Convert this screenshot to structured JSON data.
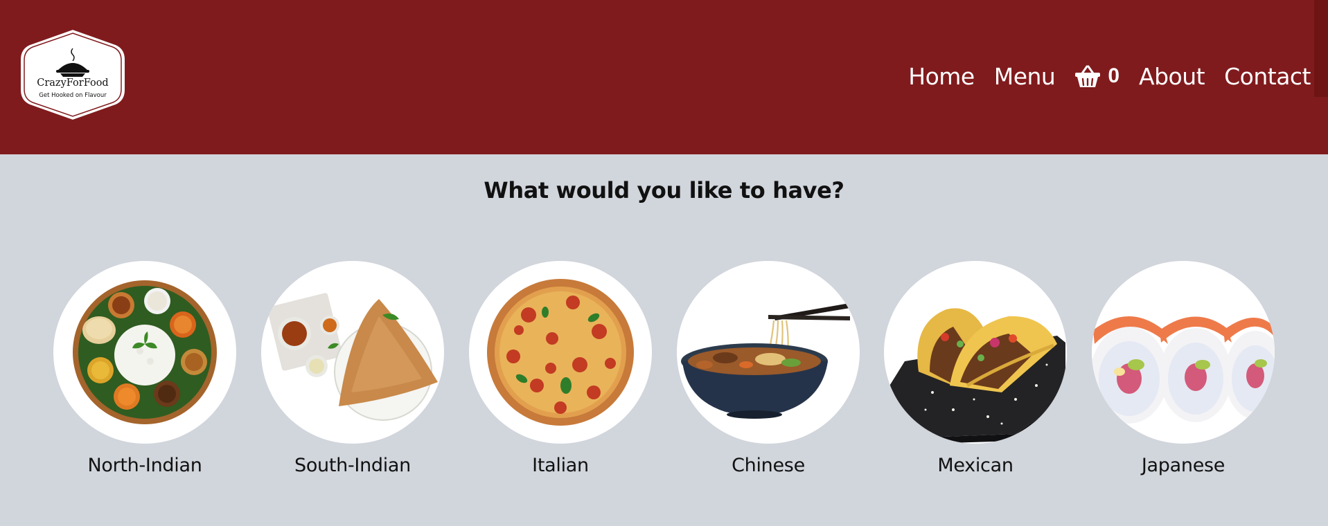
{
  "brand": {
    "name": "CrazyForFood",
    "tagline": "Get Hooked on Flavour"
  },
  "nav": {
    "home": "Home",
    "menu": "Menu",
    "cart_count": "0",
    "about": "About",
    "contact": "Contact"
  },
  "main": {
    "heading": "What would you like to have?",
    "cuisines": [
      {
        "label": "North-Indian",
        "image": "indian-thali"
      },
      {
        "label": "South-Indian",
        "image": "dosa"
      },
      {
        "label": "Italian",
        "image": "pizza"
      },
      {
        "label": "Chinese",
        "image": "noodle-bowl"
      },
      {
        "label": "Mexican",
        "image": "tacos"
      },
      {
        "label": "Japanese",
        "image": "sushi-rolls"
      }
    ]
  },
  "icons": {
    "cart": "basket-icon",
    "logo": "pie-dish-icon"
  },
  "colors": {
    "header": "#801b1d",
    "background": "#d1d5dc",
    "nav_text": "#ffffff"
  }
}
